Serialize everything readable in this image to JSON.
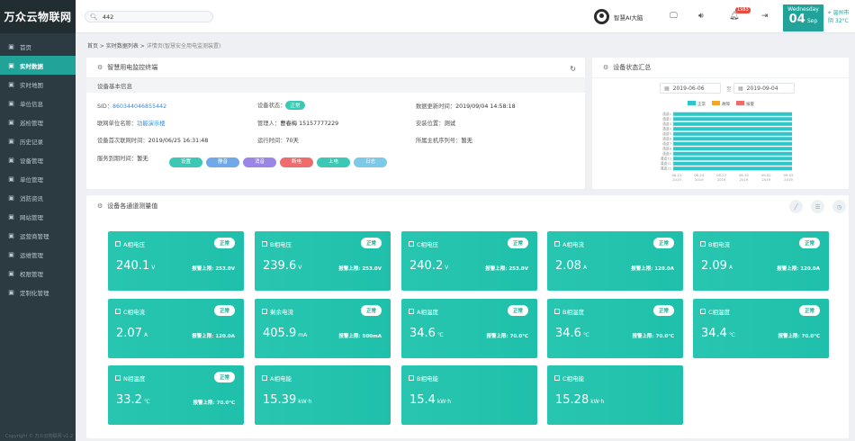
{
  "app": {
    "logo": "万众云物联网",
    "footer": "Copyright © 万众云物联网 v1.2"
  },
  "sidebar": {
    "items": [
      {
        "label": "首页",
        "icon": "home-icon"
      },
      {
        "label": "实时数据",
        "icon": "chart-icon",
        "active": true
      },
      {
        "label": "实时地图",
        "icon": "map-icon"
      },
      {
        "label": "单位信息",
        "icon": "building-icon"
      },
      {
        "label": "巡检管理",
        "icon": "inspect-icon"
      },
      {
        "label": "历史记录",
        "icon": "history-icon"
      },
      {
        "label": "设备管理",
        "icon": "device-icon"
      },
      {
        "label": "单位管理",
        "icon": "unit-icon"
      },
      {
        "label": "消防资讯",
        "icon": "news-icon"
      },
      {
        "label": "网站管理",
        "icon": "web-icon"
      },
      {
        "label": "运营商管理",
        "icon": "operator-icon"
      },
      {
        "label": "运维管理",
        "icon": "maintenance-icon"
      },
      {
        "label": "权限管理",
        "icon": "permission-icon"
      },
      {
        "label": "定制化管理",
        "icon": "custom-icon"
      }
    ]
  },
  "header": {
    "search_value": "442",
    "user_name": "智慧AI大脑",
    "notification_count": "1983",
    "weekday": "Wednesday",
    "day": "04",
    "month": "Sep",
    "city": "温州市",
    "weather": "阴 32°C"
  },
  "breadcrumb": {
    "home": "首页",
    "list": "实时数据列表",
    "current": "详情页(智慧安全用电监测装置)"
  },
  "device_panel": {
    "title": "智慧用电监控终端",
    "section": "设备基本信息",
    "sid_label": "SID：",
    "sid": "860344046855442",
    "status_label": "设备状态：",
    "status": "正常",
    "update_label": "数据更新时间：",
    "update": "2019/09/04 14:58:18",
    "unit_label": "联网单位名称：",
    "unit": "功能演示楼",
    "manager_label": "管理人：",
    "manager": "曹春梅 15157777229",
    "location_label": "安装位置：",
    "location": "测试",
    "first_label": "设备首次联网时间：",
    "first": "2019/06/25 16:31:48",
    "runtime_label": "运行时间：",
    "runtime": "70天",
    "host_label": "所属主机序列号：",
    "host": "暂无",
    "expire_label": "服务到期时间：",
    "expire": "暂无",
    "buttons": [
      {
        "label": "设置",
        "color": "#3cc8b4"
      },
      {
        "label": "静音",
        "color": "#6fa9e8"
      },
      {
        "label": "消音",
        "color": "#9b86e6"
      },
      {
        "label": "断电",
        "color": "#f06b6b"
      },
      {
        "label": "上电",
        "color": "#3cc8b4"
      },
      {
        "label": "日志",
        "color": "#7cc9e8"
      }
    ]
  },
  "status_panel": {
    "title": "设备状态汇总",
    "date_from": "2019-06-06",
    "date_sep": "至",
    "date_to": "2019-09-04"
  },
  "chart_data": {
    "type": "bar",
    "orientation": "horizontal",
    "legend": [
      "正常",
      "故障",
      "报警"
    ],
    "legend_colors": [
      "#2ec7c9",
      "#f5a623",
      "#ef6b6b"
    ],
    "categories": [
      "通道1",
      "通道2",
      "通道3",
      "通道4",
      "通道5",
      "通道6",
      "通道7",
      "通道8",
      "通道9",
      "通道10",
      "通道11",
      "通道12"
    ],
    "series": [
      {
        "name": "正常",
        "values": [
          100,
          100,
          100,
          100,
          100,
          100,
          100,
          100,
          100,
          100,
          100,
          100
        ]
      },
      {
        "name": "故障",
        "values": [
          0,
          0,
          0,
          0,
          0,
          0,
          0,
          0,
          0,
          0,
          0,
          0
        ]
      },
      {
        "name": "报警",
        "values": [
          0,
          0,
          0,
          0,
          0,
          0,
          0,
          0,
          0,
          0,
          0,
          0
        ]
      }
    ],
    "x_ticks": [
      "08-21 2019",
      "08-24 2019",
      "08-27 2019",
      "08-30 2019",
      "09-02 2019",
      "09-05 2019"
    ],
    "legend_position": "top"
  },
  "channel_panel": {
    "title": "设备各通道测量值",
    "cards": [
      {
        "name": "A相电压",
        "status": "正常",
        "value": "240.1",
        "unit": "V",
        "limit": "报警上限: 253.0V"
      },
      {
        "name": "B相电压",
        "status": "正常",
        "value": "239.6",
        "unit": "V",
        "limit": "报警上限: 253.0V"
      },
      {
        "name": "C相电压",
        "status": "正常",
        "value": "240.2",
        "unit": "V",
        "limit": "报警上限: 253.0V"
      },
      {
        "name": "A相电流",
        "status": "正常",
        "value": "2.08",
        "unit": "A",
        "limit": "报警上限: 120.0A"
      },
      {
        "name": "B相电流",
        "status": "正常",
        "value": "2.09",
        "unit": "A",
        "limit": "报警上限: 120.0A"
      },
      {
        "name": "C相电流",
        "status": "正常",
        "value": "2.07",
        "unit": "A",
        "limit": "报警上限: 120.0A"
      },
      {
        "name": "剩余电流",
        "status": "正常",
        "value": "405.9",
        "unit": "mA",
        "limit": "报警上限: 500mA"
      },
      {
        "name": "A相温度",
        "status": "正常",
        "value": "34.6",
        "unit": "℃",
        "limit": "报警上限: 70.0°C"
      },
      {
        "name": "B相温度",
        "status": "正常",
        "value": "34.6",
        "unit": "℃",
        "limit": "报警上限: 70.0°C"
      },
      {
        "name": "C相温度",
        "status": "正常",
        "value": "34.4",
        "unit": "℃",
        "limit": "报警上限: 70.0°C"
      },
      {
        "name": "N相温度",
        "status": "正常",
        "value": "33.2",
        "unit": "℃",
        "limit": "报警上限: 70.0°C"
      },
      {
        "name": "A相电能",
        "status": "",
        "value": "15.39",
        "unit": "kW·h",
        "limit": ""
      },
      {
        "name": "B相电能",
        "status": "",
        "value": "15.4",
        "unit": "kW·h",
        "limit": ""
      },
      {
        "name": "C相电能",
        "status": "",
        "value": "15.28",
        "unit": "kW·h",
        "limit": ""
      }
    ]
  }
}
